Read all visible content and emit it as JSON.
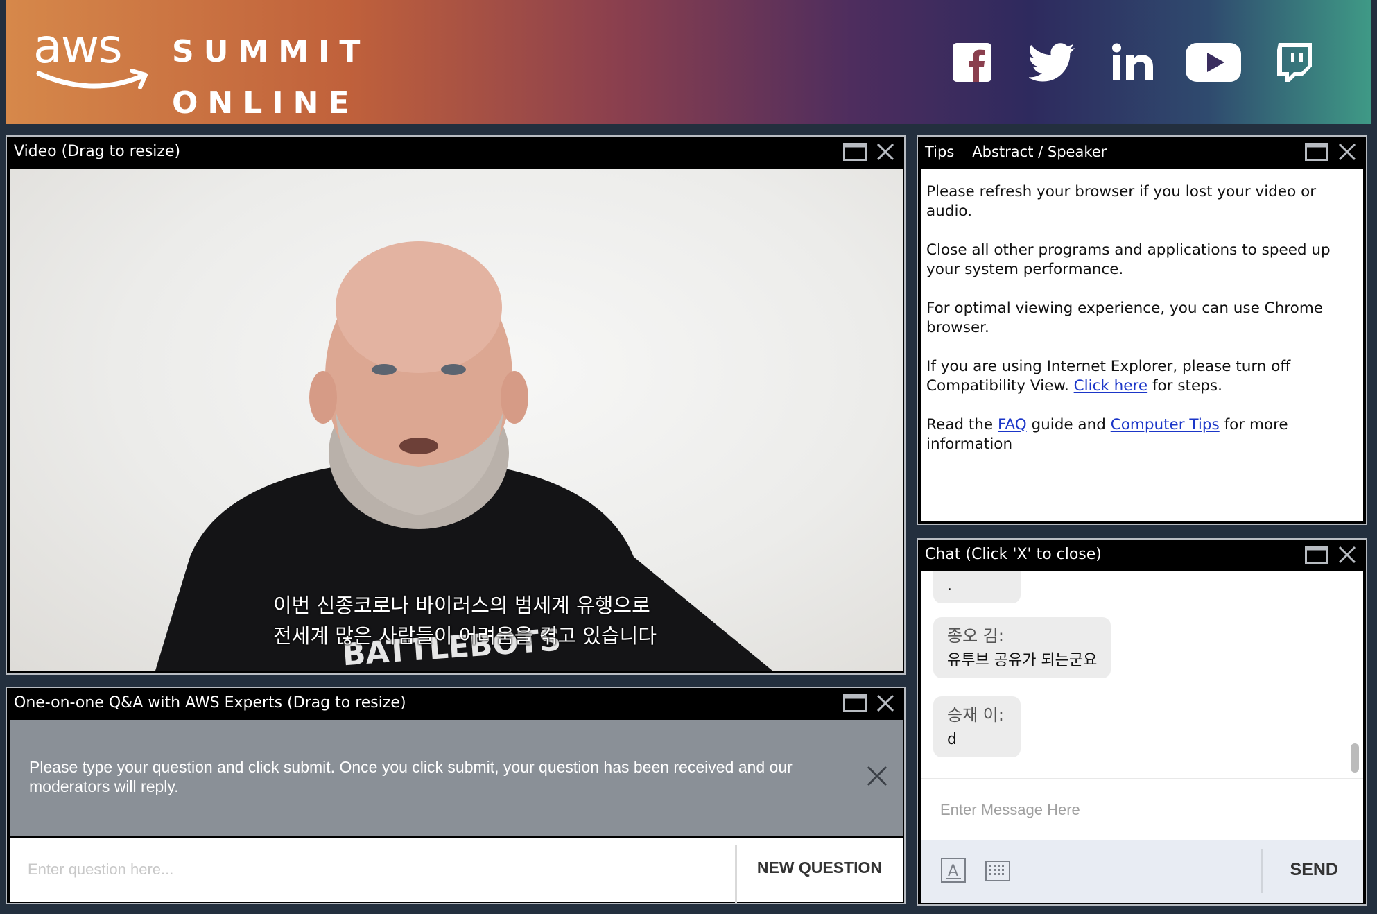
{
  "header": {
    "logo_text": "aws",
    "summit_line1": "SUMMIT",
    "summit_line2": "ONLINE",
    "socials": [
      "facebook-icon",
      "twitter-icon",
      "linkedin-icon",
      "youtube-icon",
      "twitch-icon"
    ]
  },
  "video_panel": {
    "title": "Video (Drag to resize)",
    "subtitle_line1": "이번 신종코로나 바이러스의 범세계 유행으로",
    "subtitle_line2": "전세계 많은 사람들이 어려움을 겪고 있습니다",
    "shirt_text": "BATTLEBOTS"
  },
  "qa_panel": {
    "title": "One-on-one Q&A with AWS Experts (Drag to resize)",
    "notice": "Please type your question and click submit. Once you click submit, your question has been received and our moderators will reply.",
    "input_placeholder": "Enter question here...",
    "button_label": "NEW QUESTION"
  },
  "tips_panel": {
    "tabs": [
      "Tips",
      "Abstract / Speaker"
    ],
    "p1": "Please refresh your browser if you lost your video or audio.",
    "p2": "Close all other programs and applications to speed up your system performance.",
    "p3": "For optimal viewing experience, you can use Chrome browser.",
    "p4_before": "If you are using Internet Explorer, please turn off Compatibility View. ",
    "p4_link": "Click here",
    "p4_after": " for steps.",
    "p5_before": "Read the ",
    "p5_link1": "FAQ",
    "p5_mid": " guide and ",
    "p5_link2": "Computer Tips",
    "p5_after": " for more information"
  },
  "chat_panel": {
    "title": "Chat (Click 'X' to close)",
    "messages": [
      {
        "author": "",
        "text": "."
      },
      {
        "author": "종오 김:",
        "text": "유투브 공유가 되는군요"
      },
      {
        "author": "승재 이:",
        "text": "d"
      }
    ],
    "input_placeholder": "Enter Message Here",
    "send_label": "SEND"
  },
  "colors": {
    "link": "#1b36c8",
    "panel_border": "#b8bcc2",
    "page_bg": "#232f3e"
  }
}
